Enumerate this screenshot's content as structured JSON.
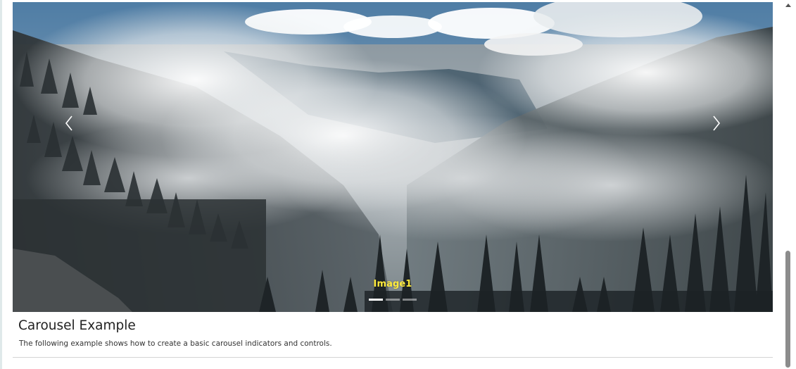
{
  "carousel": {
    "caption": "Image1",
    "prev_label": "Previous",
    "next_label": "Next",
    "slide_count": 3,
    "active_index": 0,
    "image_description": "Misty mountain valley with evergreen forest and clouds"
  },
  "section": {
    "title": "Carousel Example",
    "description": "The following example shows how to create a basic carousel indicators and controls."
  },
  "colors": {
    "caption": "#ffea3b",
    "indicator_active": "#ffffff",
    "scroll_thumb": "#8c8c8c"
  },
  "icons": {
    "prev": "chevron-left-icon",
    "next": "chevron-right-icon"
  }
}
